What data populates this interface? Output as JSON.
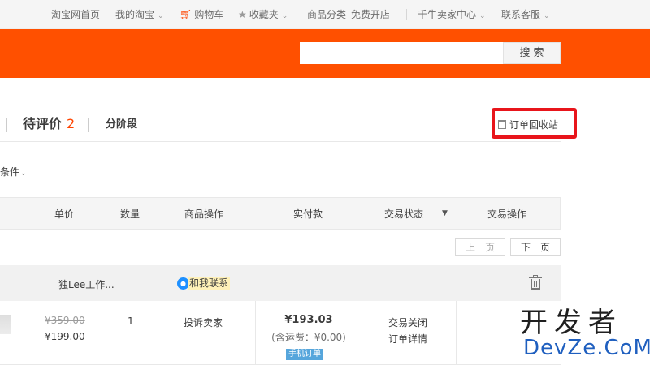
{
  "site_nav": {
    "home": "淘宝网首页",
    "my_taobao": "我的淘宝",
    "cart": "购物车",
    "favorites": "收藏夹",
    "categories": "商品分类",
    "open_shop": "免费开店",
    "seller_center": "千牛卖家中心",
    "customer_service": "联系客服"
  },
  "search": {
    "value": "",
    "button_label": "搜索"
  },
  "tabs": {
    "pending_review_label": "待评价",
    "pending_review_count": "2",
    "stage_label": "分阶段"
  },
  "recycle_bin_label": "订单回收站",
  "filter_label": "条件",
  "table_headers": [
    "单价",
    "数量",
    "商品操作",
    "实付款",
    "交易状态",
    "交易操作"
  ],
  "pager": {
    "prev": "上一页",
    "next": "下一页"
  },
  "order": {
    "shop_name": "独Lee工作...",
    "contact_label": "和我联系",
    "original_price": "¥359.00",
    "price": "¥199.00",
    "quantity": "1",
    "item_action": "投诉卖家",
    "paid": "¥193.03",
    "shipping": "(含运费：¥0.00)",
    "source_tag": "手机订单",
    "status": "交易关闭",
    "detail_link": "订单详情"
  },
  "watermark": {
    "cn": "开发者",
    "en": "DevZe.CoM"
  },
  "colors": {
    "brand_orange": "#ff5000",
    "count_orange": "#ff4400",
    "highlight_red": "#e8151b"
  }
}
